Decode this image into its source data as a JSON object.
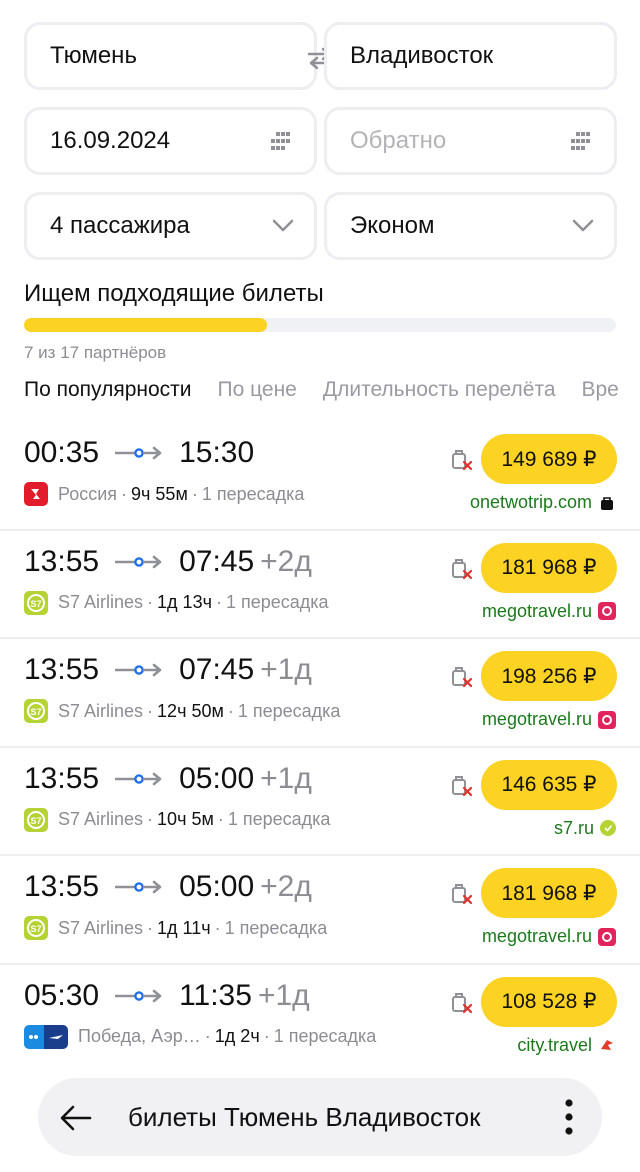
{
  "form": {
    "from": "Тюмень",
    "to": "Владивосток",
    "date": "16.09.2024",
    "return_placeholder": "Обратно",
    "passengers": "4 пассажира",
    "class": "Эконом"
  },
  "search": {
    "status": "Ищем подходящие билеты",
    "progress_percent": 41,
    "partners": "7 из 17 партнёров"
  },
  "tabs": [
    {
      "label": "По популярности",
      "active": true
    },
    {
      "label": "По цене",
      "active": false
    },
    {
      "label": "Длительность перелёта",
      "active": false
    },
    {
      "label": "Время",
      "active": false
    }
  ],
  "tabs_visible_last": "Вре",
  "colors": {
    "accent": "#fcd223",
    "agency_green": "#1b7a1b",
    "s7": "#b5d334",
    "rossiya": "#e21c2a",
    "megotravel": "#e2245c"
  },
  "flights": [
    {
      "dep": "00:35",
      "arr": "15:30",
      "plus": "",
      "airline": "Россия",
      "airline_icon": "rossiya-logo",
      "duration": "9ч 55м",
      "stops": "1 пересадка",
      "price": "149 689 ₽",
      "agency": "onetwotrip.com",
      "agency_icon": "bag-icon"
    },
    {
      "dep": "13:55",
      "arr": "07:45",
      "plus": "+2д",
      "airline": "S7 Airlines",
      "airline_icon": "s7-logo",
      "duration": "1д 13ч",
      "stops": "1 пересадка",
      "price": "181 968 ₽",
      "agency": "megotravel.ru",
      "agency_icon": "megotravel-icon"
    },
    {
      "dep": "13:55",
      "arr": "07:45",
      "plus": "+1д",
      "airline": "S7 Airlines",
      "airline_icon": "s7-logo",
      "duration": "12ч 50м",
      "stops": "1 пересадка",
      "price": "198 256 ₽",
      "agency": "megotravel.ru",
      "agency_icon": "megotravel-icon"
    },
    {
      "dep": "13:55",
      "arr": "05:00",
      "plus": "+1д",
      "airline": "S7 Airlines",
      "airline_icon": "s7-logo",
      "duration": "10ч 5м",
      "stops": "1 пересадка",
      "price": "146 635 ₽",
      "agency": "s7.ru",
      "agency_icon": "s7-small-icon"
    },
    {
      "dep": "13:55",
      "arr": "05:00",
      "plus": "+2д",
      "airline": "S7 Airlines",
      "airline_icon": "s7-logo",
      "duration": "1д 11ч",
      "stops": "1 пересадка",
      "price": "181 968 ₽",
      "agency": "megotravel.ru",
      "agency_icon": "megotravel-icon"
    },
    {
      "dep": "05:30",
      "arr": "11:35",
      "plus": "+1д",
      "airline": "Победа, Аэр…",
      "airline_icon": "pobeda-aeroflot-logos",
      "duration": "1д 2ч",
      "stops": "1 пересадка",
      "price": "108 528 ₽",
      "agency": "city.travel",
      "agency_icon": "city-travel-icon"
    }
  ],
  "bottom_bar": {
    "query": "билеты Тюмень Владивосток"
  }
}
